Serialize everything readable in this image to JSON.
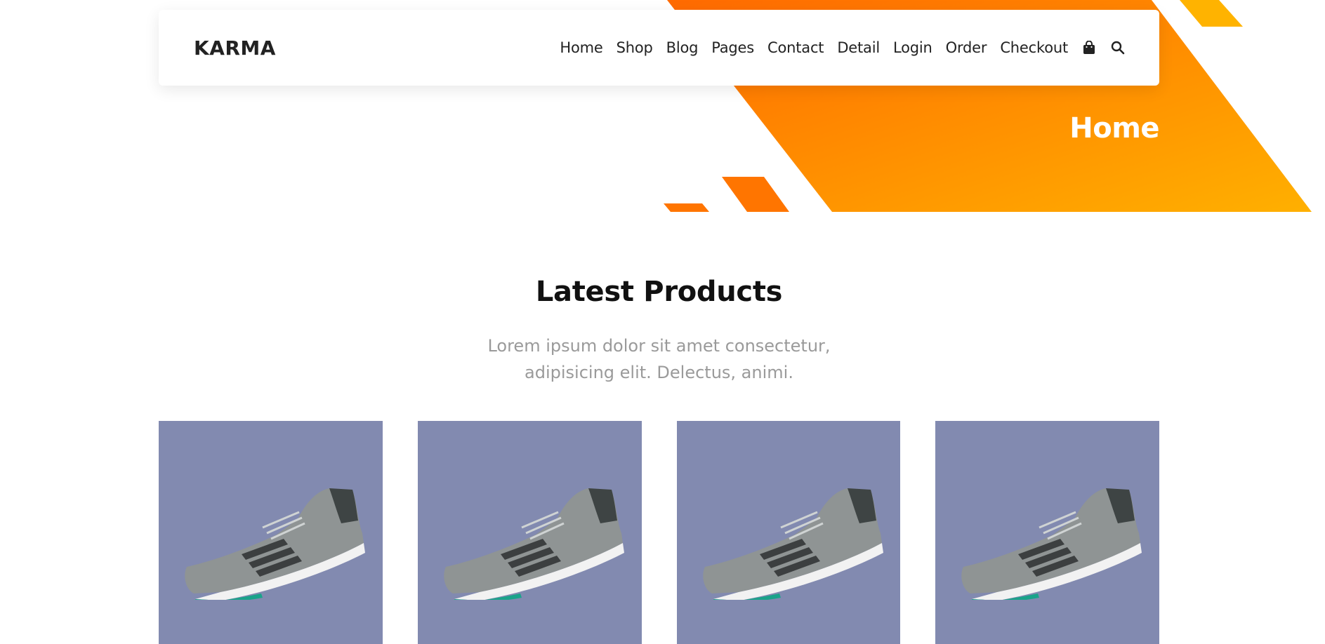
{
  "header": {
    "logo": "KARMA",
    "nav": [
      {
        "label": "Home"
      },
      {
        "label": "Shop"
      },
      {
        "label": "Blog"
      },
      {
        "label": "Pages"
      },
      {
        "label": "Contact"
      },
      {
        "label": "Detail"
      },
      {
        "label": "Login"
      },
      {
        "label": "Order"
      },
      {
        "label": "Checkout"
      }
    ],
    "icons": [
      "shopping-bag-icon",
      "search-icon"
    ]
  },
  "hero": {
    "title": "Home"
  },
  "section": {
    "title": "Latest Products",
    "subtitle_line1": "Lorem ipsum dolor sit amet consectetur,",
    "subtitle_line2": "adipisicing elit. Delectus, animi."
  },
  "products": [
    {
      "image": "sneaker-image"
    },
    {
      "image": "sneaker-image"
    },
    {
      "image": "sneaker-image"
    },
    {
      "image": "sneaker-image"
    }
  ],
  "colors": {
    "accent_orange": "#ff7a00",
    "accent_yellow": "#ffb300",
    "product_bg": "#828ab0",
    "text_dark": "#222222",
    "text_muted": "#9a9a9a"
  }
}
